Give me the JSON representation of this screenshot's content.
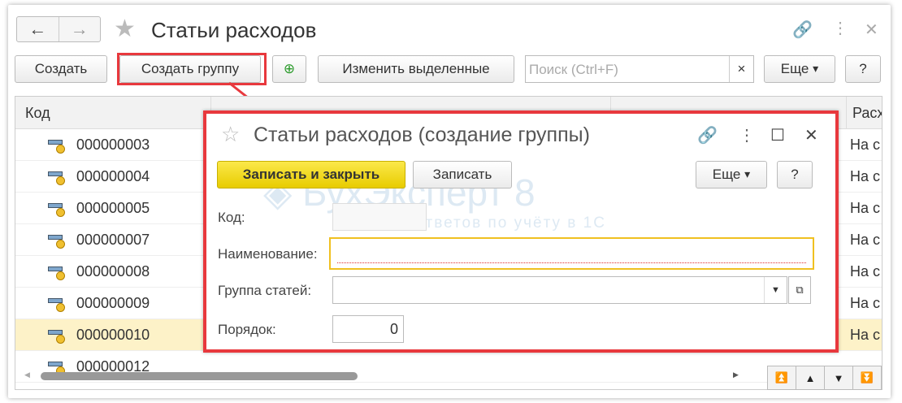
{
  "window": {
    "title": "Статьи расходов",
    "back": "←",
    "forward": "→"
  },
  "toolbar": {
    "create": "Создать",
    "create_group": "Создать группу",
    "edit_selected": "Изменить выделенные",
    "search_placeholder": "Поиск (Ctrl+F)",
    "clear": "×",
    "more": "Еще",
    "help": "?"
  },
  "table": {
    "headers": [
      "Код",
      "",
      "",
      "Расх"
    ],
    "rows": [
      {
        "code": "000000003",
        "last": "На с"
      },
      {
        "code": "000000004",
        "last": "На с"
      },
      {
        "code": "000000005",
        "last": "На с"
      },
      {
        "code": "000000007",
        "last": "На с"
      },
      {
        "code": "000000008",
        "last": "На с"
      },
      {
        "code": "000000009",
        "last": "На с"
      },
      {
        "code": "000000010",
        "last": "На с",
        "selected": true
      },
      {
        "code": "000000012",
        "last": ""
      }
    ]
  },
  "dialog": {
    "title": "Статьи расходов (создание группы)",
    "save_close": "Записать и закрыть",
    "save": "Записать",
    "more": "Еще",
    "help": "?",
    "fields": {
      "code_label": "Код:",
      "code_value": "",
      "name_label": "Наименование:",
      "name_value": "",
      "group_label": "Группа статей:",
      "group_value": "",
      "order_label": "Порядок:",
      "order_value": "0"
    }
  },
  "watermark": {
    "brand": "БухЭксперт",
    "version": "8",
    "tagline": "База ответов по учёту в 1С"
  },
  "colors": {
    "highlight": "#e8383d",
    "primary_button": "#f5d800",
    "selected_row": "#fdf2c8"
  }
}
